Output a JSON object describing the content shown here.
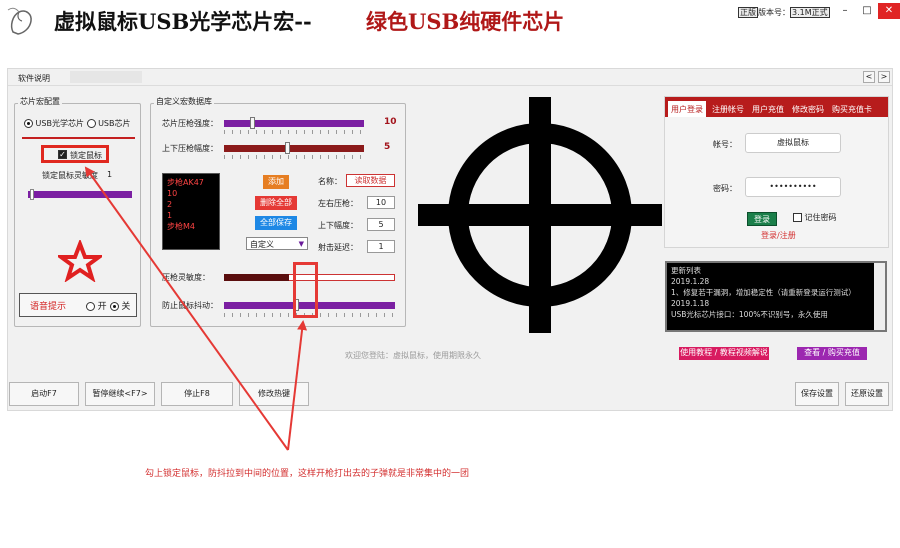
{
  "app": {
    "title": "虚拟鼠标USB光学芯片宏--",
    "title_accent": "绿色USB纯硬件芯片",
    "version_label": "版本号：",
    "version_value": "3.1M正式",
    "version_prefix": "正版",
    "min_symbol": "–",
    "max_symbol": "□",
    "close_symbol": "✕"
  },
  "tabs": {
    "help_label": "软件说明",
    "prev_symbol": "<",
    "next_symbol": ">"
  },
  "chip": {
    "group_title": "芯片宏配置",
    "radio_usb": "USB光学芯片",
    "radio_normal": "USB芯片",
    "lock_mouse": "锁定鼠标",
    "sensitivity_label": "锁定鼠标灵敏度",
    "sensitivity_value": "1",
    "sensitivity_level": 0.02,
    "voice_label": "语音提示",
    "voice_on": "开",
    "voice_off": "关",
    "star_color": "#e02020"
  },
  "macro": {
    "group_title": "自定义宏数据库",
    "slider1_label": "芯片压枪强度：",
    "slider1_value": "10",
    "slider1_level": 0.2,
    "slider1_color": "#7b1fa2",
    "slider2_label": "上下压枪幅度：",
    "slider2_value": "5",
    "slider2_level": 0.45,
    "slider2_color": "#8b1a1a",
    "list_items": [
      "步枪AK47",
      "10",
      "2",
      "1",
      "步枪M4"
    ],
    "add_label": "添加",
    "delall_label": "删除全部",
    "saveall_label": "全部保存",
    "select_value": "自定义",
    "name_label": "名称：",
    "name_value": "读取数据",
    "rate_label": "左右压枪：",
    "rate_value": "10",
    "updown_label": "上下幅度：",
    "updown_value": "5",
    "delay_label": "射击延迟：",
    "delay_value": "1",
    "slider3_label": "压枪灵敏度：",
    "slider3_level": 0.38,
    "slider3_color": "#5a0e0e",
    "slider4_label": "防止鼠标抖动：",
    "slider4_level": 0.42,
    "slider4_color": "#7b1fa2"
  },
  "login": {
    "tabs": [
      "用户登录",
      "注册帐号",
      "用户充值",
      "修改密码",
      "购买充值卡"
    ],
    "account_label": "帐号：",
    "account_value": "虚拟鼠标",
    "password_label": "密码：",
    "password_value": "••••••••••",
    "login_button": "登录",
    "remember_label": "记住密码",
    "register_link": "登录/注册"
  },
  "updates": {
    "title": "更新列表",
    "lines": [
      "2019.1.28",
      "1、修复若干漏洞，增加稳定性（请重新登录运行测试）",
      "2019.1.18",
      "USB光标芯片接口：100%不识别号，永久使用"
    ]
  },
  "links": {
    "tutorial": "使用教程 / 教程视频解说",
    "buy": "查看 / 购买充值"
  },
  "welcome_text": "欢迎您登陆：虚拟鼠标，使用期限永久",
  "bottom": {
    "start": "启动F7",
    "pause": "暂停继续<F7>",
    "stop": "停止F8",
    "edit": "修改热键",
    "save_settings": "保存设置",
    "restore": "还原设置"
  },
  "annotation": {
    "text": "勾上锁定鼠标，防抖拉到中间的位置，这样开枪打出去的子弹就是非常集中的一团",
    "color": "#e53935"
  }
}
